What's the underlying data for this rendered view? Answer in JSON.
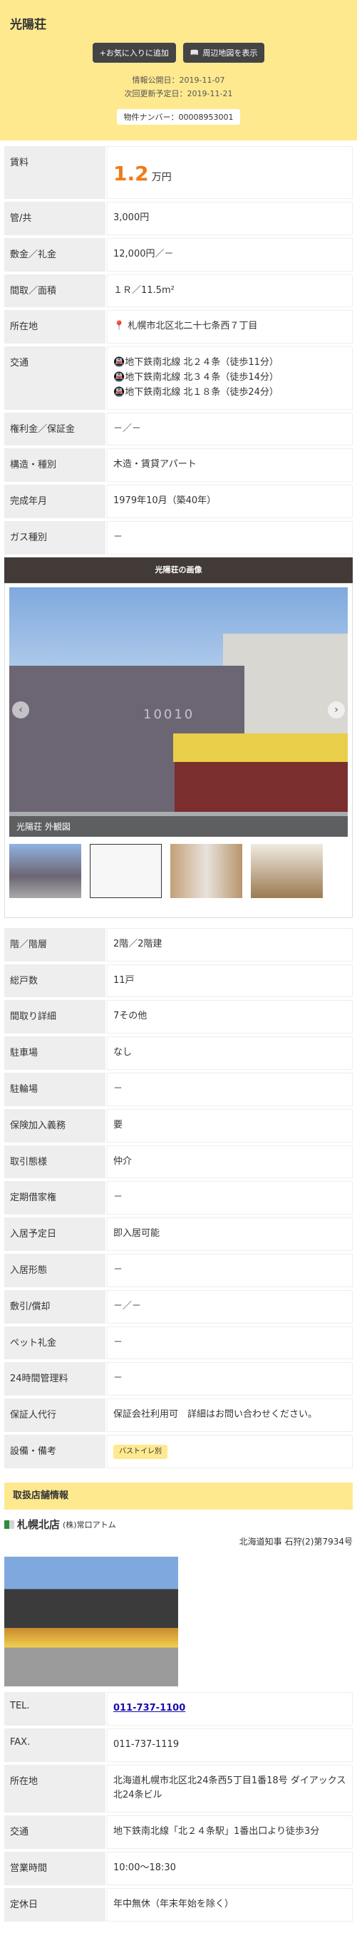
{
  "header": {
    "title": "光陽荘",
    "fav_button": "+お気に入りに追加",
    "map_button": "周辺地図を表示",
    "published": "情報公開日：2019-11-07",
    "next_update": "次回更新予定日：2019-11-21",
    "property_no": "物件ナンバー：00008953001"
  },
  "details": [
    {
      "label": "賃料",
      "value": "1.2",
      "unit": "万円"
    },
    {
      "label": "管/共",
      "value": "3,000円"
    },
    {
      "label": "敷金／礼金",
      "value": "12,000円／－"
    },
    {
      "label": "間取／面積",
      "value": "１Ｒ／11.5m²"
    },
    {
      "label": "所在地",
      "value": "札幌市北区北二十七条西７丁目"
    },
    {
      "label": "交通",
      "lines": [
        "地下鉄南北線 北２４条（徒歩11分）",
        "地下鉄南北線 北３４条（徒歩14分）",
        "地下鉄南北線 北１８条（徒歩24分）"
      ]
    },
    {
      "label": "権利金／保証金",
      "value": "－／－"
    },
    {
      "label": "構造・種別",
      "value": "木造・賃貸アパート"
    },
    {
      "label": "完成年月",
      "value": "1979年10月（築40年）"
    },
    {
      "label": "ガス種別",
      "value": "－"
    }
  ],
  "gallery": {
    "heading": "光陽荘の画像",
    "caption": "光陽荘 外観図",
    "watermark": "10010"
  },
  "details2": [
    {
      "label": "階／階層",
      "value": "2階／2階建"
    },
    {
      "label": "総戸数",
      "value": "11戸"
    },
    {
      "label": "間取り詳細",
      "value": "7その他"
    },
    {
      "label": "駐車場",
      "value": "なし"
    },
    {
      "label": "駐輪場",
      "value": "－"
    },
    {
      "label": "保険加入義務",
      "value": "要"
    },
    {
      "label": "取引態様",
      "value": "仲介"
    },
    {
      "label": "定期借家権",
      "value": "－"
    },
    {
      "label": "入居予定日",
      "value": "即入居可能"
    },
    {
      "label": "入居形態",
      "value": "－"
    },
    {
      "label": "敷引/償却",
      "value": "－／－"
    },
    {
      "label": "ペット礼金",
      "value": "－"
    },
    {
      "label": "24時間管理料",
      "value": "－"
    },
    {
      "label": "保証人代行",
      "value": "保証会社利用可　詳細はお問い合わせください。"
    },
    {
      "label": "設備・備考",
      "value": "バストイレ別"
    }
  ],
  "shop": {
    "heading": "取扱店舗情報",
    "name": "札幌北店",
    "company": "(株)常口アトム",
    "license": "北海道知事 石狩(2)第7934号",
    "rows": [
      {
        "label": "TEL.",
        "value": "011-737-1100"
      },
      {
        "label": "FAX.",
        "value": "011-737-1119"
      },
      {
        "label": "所在地",
        "value": "北海道札幌市北区北24条西5丁目1番18号 ダイアックス北24条ビル"
      },
      {
        "label": "交通",
        "value": "地下鉄南北線「北２４条駅」1番出口より徒歩3分"
      },
      {
        "label": "営業時間",
        "value": "10:00〜18:30"
      },
      {
        "label": "定休日",
        "value": "年中無休（年末年始を除く）"
      }
    ]
  }
}
